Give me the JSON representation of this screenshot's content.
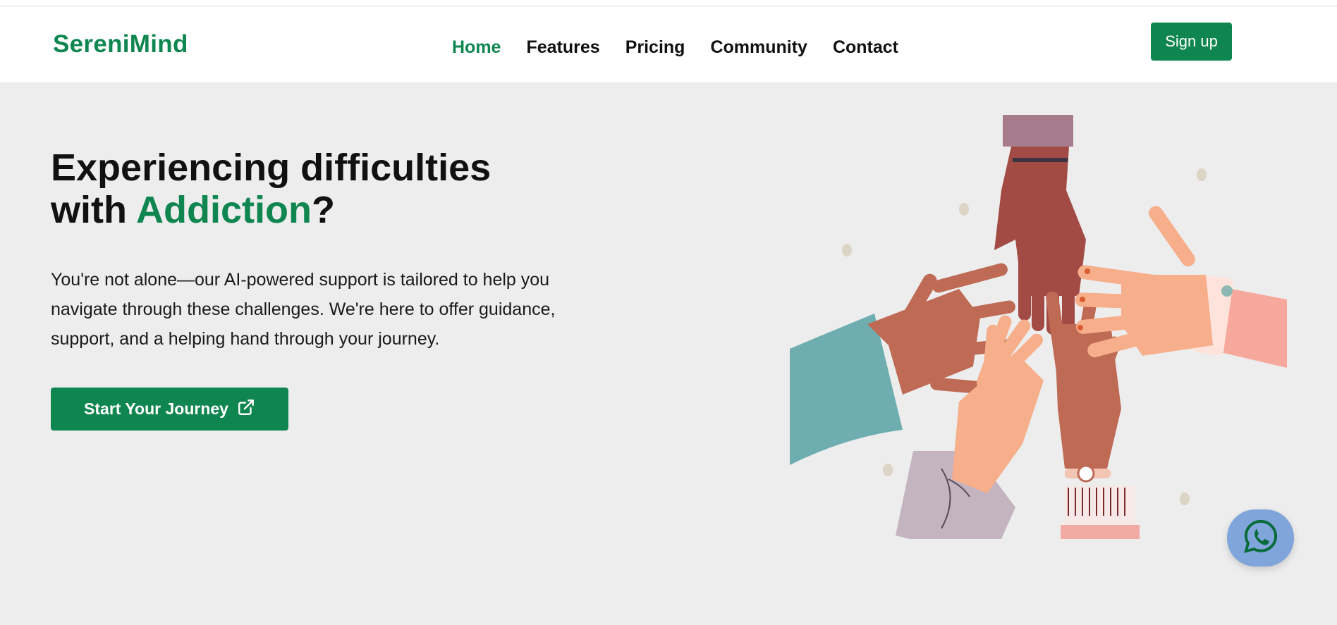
{
  "brand": {
    "name": "SereniMind",
    "color": "#0f8650"
  },
  "nav": {
    "items": [
      {
        "label": "Home",
        "active": true
      },
      {
        "label": "Features",
        "active": false
      },
      {
        "label": "Pricing",
        "active": false
      },
      {
        "label": "Community",
        "active": false
      },
      {
        "label": "Contact",
        "active": false
      }
    ]
  },
  "header": {
    "signup_label": "Sign up"
  },
  "hero": {
    "title_line1": "Experiencing difficulties",
    "title_prefix": "with ",
    "title_accent": "Addiction",
    "title_suffix": "?",
    "description": "You're not alone—our AI-powered support is tailored to help you navigate through these challenges. We're here to offer guidance, support, and a helping hand through your journey.",
    "cta_label": "Start Your Journey",
    "cta_icon": "external-link-icon",
    "illustration_icon": "hands-together-illustration"
  },
  "chat": {
    "icon": "whatsapp-icon",
    "color": "#7fa5db"
  }
}
